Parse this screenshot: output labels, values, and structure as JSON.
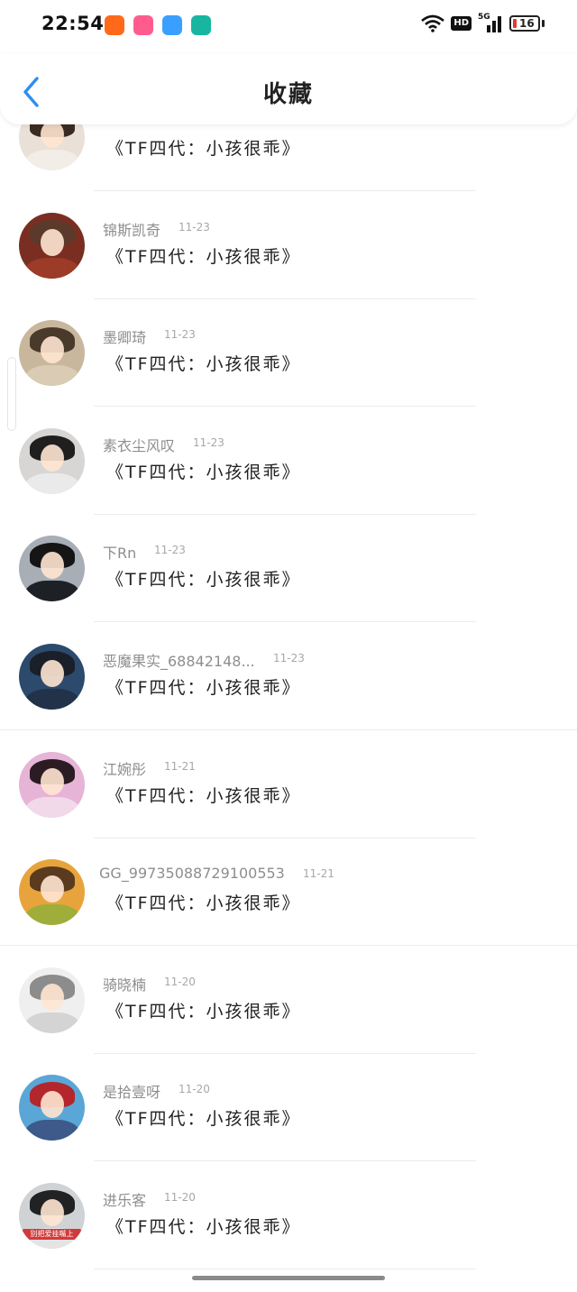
{
  "status_bar": {
    "time": "22:54",
    "network": "5G",
    "hd_label": "HD",
    "battery": "16",
    "app_icons": [
      {
        "name": "kuaishou-icon",
        "color": "#ff6a1a"
      },
      {
        "name": "bilibili-icon",
        "color": "#ff5c8d"
      },
      {
        "name": "weather-icon",
        "color": "#3aa0ff"
      },
      {
        "name": "hotspot-icon",
        "color": "#18b6a0"
      }
    ]
  },
  "header": {
    "title": "收藏"
  },
  "items": [
    {
      "username": "",
      "date": "",
      "title": "《TF四代：小孩很乖》",
      "avatar": {
        "bg": "#e9e1d8",
        "hair": "#3b2c22",
        "body": "#f2ede6"
      }
    },
    {
      "username": "锦斯凯奇",
      "date": "11-23",
      "title": "《TF四代：小孩很乖》",
      "avatar": {
        "bg": "#7a2e22",
        "hair": "#5c3a2b",
        "body": "#9b3b28"
      }
    },
    {
      "username": "墨卿琦",
      "date": "11-23",
      "title": "《TF四代：小孩很乖》",
      "avatar": {
        "bg": "#c9b79d",
        "hair": "#4a3a2c",
        "body": "#d9cbb4"
      }
    },
    {
      "username": "素衣尘风叹",
      "date": "11-23",
      "title": "《TF四代：小孩很乖》",
      "avatar": {
        "bg": "#d8d6d4",
        "hair": "#1f1f1f",
        "body": "#eaeaea"
      }
    },
    {
      "username": "下Rn",
      "date": "11-23",
      "title": "《TF四代：小孩很乖》",
      "avatar": {
        "bg": "#a8aeb6",
        "hair": "#151515",
        "body": "#1d2025"
      }
    },
    {
      "username": "恶魔果实_68842148...",
      "date": "11-23",
      "title": "《TF四代：小孩很乖》",
      "avatar": {
        "bg": "#2c4a6c",
        "hair": "#1a1f2a",
        "body": "#223248"
      }
    },
    {
      "username": "江婉彤",
      "date": "11-21",
      "title": "《TF四代：小孩很乖》",
      "avatar": {
        "bg": "#e6b4d6",
        "hair": "#2a1c22",
        "body": "#f1d9ea"
      }
    },
    {
      "username": "GG_9973508872910055​3",
      "date": "11-21",
      "title": "《TF四代：小孩很乖》",
      "avatar": {
        "bg": "#e8a43c",
        "hair": "#5a3b1e",
        "body": "#9fae3a"
      }
    },
    {
      "username": "骑晓楠",
      "date": "11-20",
      "title": "《TF四代：小孩很乖》",
      "avatar": {
        "bg": "#efefef",
        "hair": "#8c8c8c",
        "body": "#d4d4d4"
      }
    },
    {
      "username": "是拾壹呀",
      "date": "11-20",
      "title": "《TF四代：小孩很乖》",
      "avatar": {
        "bg": "#5aa6d6",
        "hair": "#b3262b",
        "body": "#3d5a8a"
      }
    },
    {
      "username": "进乐客",
      "date": "11-20",
      "title": "《TF四代：小孩很乖》",
      "avatar": {
        "bg": "#cfd3d6",
        "hair": "#222222",
        "body": "#e4e4e4"
      },
      "avatar_caption": "别把爱挂嘴上"
    }
  ]
}
